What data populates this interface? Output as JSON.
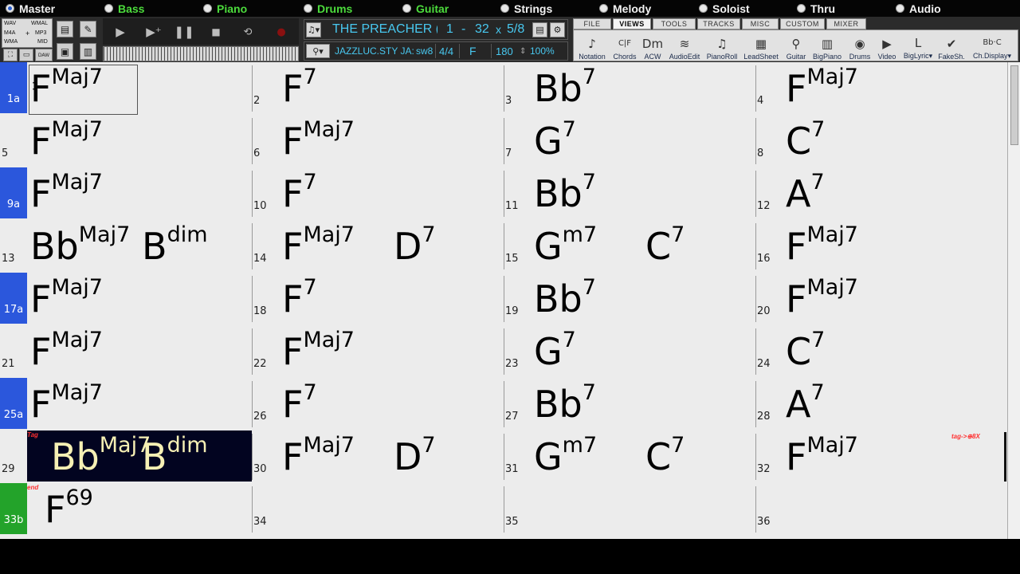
{
  "tracks": [
    {
      "label": "Master",
      "active": true,
      "color": "#f2f2f2"
    },
    {
      "label": "Bass",
      "active": false,
      "color": "#4cdc3c"
    },
    {
      "label": "Piano",
      "active": false,
      "color": "#4cdc3c"
    },
    {
      "label": "Drums",
      "active": false,
      "color": "#4cdc3c"
    },
    {
      "label": "Guitar",
      "active": false,
      "color": "#4cdc3c"
    },
    {
      "label": "Strings",
      "active": false,
      "color": "#f2f2f2"
    },
    {
      "label": "Melody",
      "active": false,
      "color": "#f2f2f2"
    },
    {
      "label": "Soloist",
      "active": false,
      "color": "#f2f2f2"
    },
    {
      "label": "Thru",
      "active": false,
      "color": "#f2f2f2"
    },
    {
      "label": "Audio",
      "active": false,
      "color": "#f2f2f2"
    }
  ],
  "file_types": {
    "wav": "WAV",
    "wmal": "WMAL",
    "m4a": "M4A",
    "plus": "+",
    "mp3": "MP3",
    "wma": "WMA",
    "mid": "MID",
    "daw": "DAW"
  },
  "song": {
    "title": "THE PREACHER (",
    "range_start": "1",
    "range_dash": "-",
    "range_end": "32",
    "times": "x",
    "choruses": "5/8"
  },
  "style": {
    "name": "JAZZLUC.STY JA:",
    "feel": "sw8",
    "time_sig": "4/4",
    "key": "F",
    "tempo": "180",
    "tempo_arrows": "⇕",
    "volume": "100%"
  },
  "tabs": [
    "FILE",
    "VIEWS",
    "TOOLS",
    "TRACKS",
    "MISC",
    "CUSTOM",
    "MIXER"
  ],
  "active_tab": "VIEWS",
  "views": [
    {
      "label": "Notation",
      "icon": "♪"
    },
    {
      "label": "Chords",
      "icon": "C|F"
    },
    {
      "label": "ACW",
      "icon": "Dm"
    },
    {
      "label": "AudioEdit",
      "icon": "≋"
    },
    {
      "label": "PianoRoll",
      "icon": "♫"
    },
    {
      "label": "LeadSheet",
      "icon": "▦"
    },
    {
      "label": "Guitar",
      "icon": "⚲"
    },
    {
      "label": "BigPiano",
      "icon": "▥"
    },
    {
      "label": "Drums",
      "icon": "◉"
    },
    {
      "label": "Video",
      "icon": "▶"
    },
    {
      "label": "BigLyric▾",
      "icon": "L"
    },
    {
      "label": "FakeSh.",
      "icon": "✔"
    },
    {
      "label": "Ch.Display▾",
      "icon": "Bb·C"
    }
  ],
  "bars": [
    {
      "num": "1a",
      "marker": "blue",
      "chords": [
        {
          "root": "F",
          "ext": "Maj7"
        }
      ],
      "selected": true
    },
    {
      "num": "2",
      "chords": [
        {
          "root": "F",
          "ext": "7"
        }
      ]
    },
    {
      "num": "3",
      "chords": [
        {
          "root": "Bb",
          "ext": "7"
        }
      ]
    },
    {
      "num": "4",
      "chords": [
        {
          "root": "F",
          "ext": "Maj7"
        }
      ]
    },
    {
      "num": "5",
      "chords": [
        {
          "root": "F",
          "ext": "Maj7"
        }
      ]
    },
    {
      "num": "6",
      "chords": [
        {
          "root": "F",
          "ext": "Maj7"
        }
      ]
    },
    {
      "num": "7",
      "chords": [
        {
          "root": "G",
          "ext": "7"
        }
      ]
    },
    {
      "num": "8",
      "chords": [
        {
          "root": "C",
          "ext": "7"
        }
      ]
    },
    {
      "num": "9a",
      "marker": "blue",
      "chords": [
        {
          "root": "F",
          "ext": "Maj7"
        }
      ]
    },
    {
      "num": "10",
      "chords": [
        {
          "root": "F",
          "ext": "7"
        }
      ]
    },
    {
      "num": "11",
      "chords": [
        {
          "root": "Bb",
          "ext": "7"
        }
      ]
    },
    {
      "num": "12",
      "chords": [
        {
          "root": "A",
          "ext": "7"
        }
      ]
    },
    {
      "num": "13",
      "chords": [
        {
          "root": "Bb",
          "ext": "Maj7"
        },
        {
          "root": "B",
          "ext": "dim"
        }
      ]
    },
    {
      "num": "14",
      "chords": [
        {
          "root": "F",
          "ext": "Maj7"
        },
        {
          "root": "D",
          "ext": "7"
        }
      ]
    },
    {
      "num": "15",
      "chords": [
        {
          "root": "G",
          "ext": "m7"
        },
        {
          "root": "C",
          "ext": "7"
        }
      ]
    },
    {
      "num": "16",
      "chords": [
        {
          "root": "F",
          "ext": "Maj7"
        }
      ]
    },
    {
      "num": "17a",
      "marker": "blue",
      "chords": [
        {
          "root": "F",
          "ext": "Maj7"
        }
      ]
    },
    {
      "num": "18",
      "chords": [
        {
          "root": "F",
          "ext": "7"
        }
      ]
    },
    {
      "num": "19",
      "chords": [
        {
          "root": "Bb",
          "ext": "7"
        }
      ]
    },
    {
      "num": "20",
      "chords": [
        {
          "root": "F",
          "ext": "Maj7"
        }
      ]
    },
    {
      "num": "21",
      "chords": [
        {
          "root": "F",
          "ext": "Maj7"
        }
      ]
    },
    {
      "num": "22",
      "chords": [
        {
          "root": "F",
          "ext": "Maj7"
        }
      ]
    },
    {
      "num": "23",
      "chords": [
        {
          "root": "G",
          "ext": "7"
        }
      ]
    },
    {
      "num": "24",
      "chords": [
        {
          "root": "C",
          "ext": "7"
        }
      ]
    },
    {
      "num": "25a",
      "marker": "blue",
      "chords": [
        {
          "root": "F",
          "ext": "Maj7"
        }
      ]
    },
    {
      "num": "26",
      "chords": [
        {
          "root": "F",
          "ext": "7"
        }
      ]
    },
    {
      "num": "27",
      "chords": [
        {
          "root": "Bb",
          "ext": "7"
        }
      ]
    },
    {
      "num": "28",
      "chords": [
        {
          "root": "A",
          "ext": "7"
        }
      ]
    },
    {
      "num": "29",
      "chords": [
        {
          "root": "Bb",
          "ext": "Maj7"
        },
        {
          "root": "B",
          "ext": "dim"
        }
      ],
      "current": true,
      "tag": "Tag"
    },
    {
      "num": "30",
      "chords": [
        {
          "root": "F",
          "ext": "Maj7"
        },
        {
          "root": "D",
          "ext": "7"
        }
      ]
    },
    {
      "num": "31",
      "chords": [
        {
          "root": "G",
          "ext": "m7"
        },
        {
          "root": "C",
          "ext": "7"
        }
      ]
    },
    {
      "num": "32",
      "chords": [
        {
          "root": "F",
          "ext": "Maj7"
        }
      ],
      "tag_right": "tag->⊕8X"
    },
    {
      "num": "33b",
      "marker": "green",
      "chords": [
        {
          "root": "F",
          "ext": "69"
        }
      ],
      "tag": "end"
    },
    {
      "num": "34",
      "chords": []
    },
    {
      "num": "35",
      "chords": []
    },
    {
      "num": "36",
      "chords": []
    }
  ]
}
